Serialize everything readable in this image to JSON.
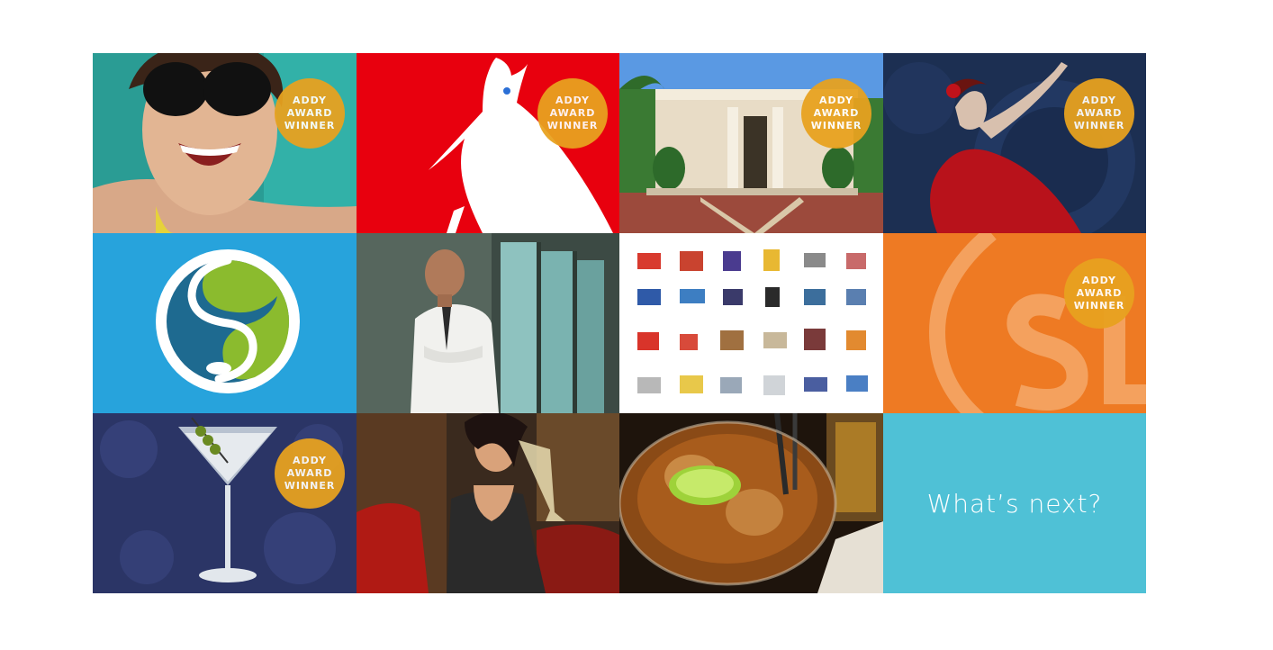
{
  "badge": {
    "line1": "ADDY",
    "line2": "AWARD",
    "line3": "WINNER"
  },
  "tiles": [
    {
      "name": "sunglasses-woman",
      "award": true
    },
    {
      "name": "pelican-logo",
      "award": true
    },
    {
      "name": "museum-building",
      "award": true
    },
    {
      "name": "flamenco-dancer",
      "award": true
    },
    {
      "name": "leaf-s-logo",
      "award": false
    },
    {
      "name": "doctor-portrait",
      "award": false
    },
    {
      "name": "product-grid",
      "award": false
    },
    {
      "name": "orange-sl-logo",
      "award": true
    },
    {
      "name": "martini-glass",
      "award": true
    },
    {
      "name": "woman-with-wine",
      "award": false
    },
    {
      "name": "iced-drink",
      "award": false
    },
    {
      "name": "whats-next",
      "award": false
    }
  ],
  "whats_next": {
    "label": "What’s next?"
  },
  "colors": {
    "badge": "#e8a21f",
    "whats_next_bg": "#4fc1d6",
    "pelican_bg": "#e8000e",
    "logo_blue_bg": "#27a3dc",
    "orange_bg": "#ee7a23"
  }
}
